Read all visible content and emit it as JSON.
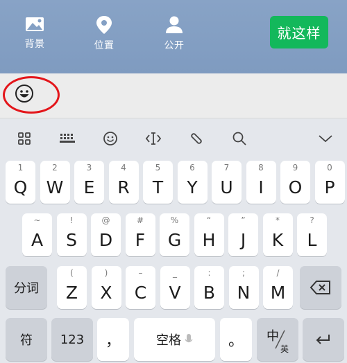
{
  "toolbar": {
    "background_label": "背景",
    "location_label": "位置",
    "public_label": "公开",
    "confirm_label": "就这样"
  },
  "keyboard": {
    "row1": [
      {
        "letter": "Q",
        "hint": "1"
      },
      {
        "letter": "W",
        "hint": "2"
      },
      {
        "letter": "E",
        "hint": "3"
      },
      {
        "letter": "R",
        "hint": "4"
      },
      {
        "letter": "T",
        "hint": "5"
      },
      {
        "letter": "Y",
        "hint": "6"
      },
      {
        "letter": "U",
        "hint": "7"
      },
      {
        "letter": "I",
        "hint": "8"
      },
      {
        "letter": "O",
        "hint": "9"
      },
      {
        "letter": "P",
        "hint": "0"
      }
    ],
    "row2": [
      {
        "letter": "A",
        "hint": "~"
      },
      {
        "letter": "S",
        "hint": "!"
      },
      {
        "letter": "D",
        "hint": "@"
      },
      {
        "letter": "F",
        "hint": "#"
      },
      {
        "letter": "G",
        "hint": "%"
      },
      {
        "letter": "H",
        "hint": "“"
      },
      {
        "letter": "J",
        "hint": "”"
      },
      {
        "letter": "K",
        "hint": "*"
      },
      {
        "letter": "L",
        "hint": "?"
      }
    ],
    "row3": [
      {
        "letter": "Z",
        "hint": "("
      },
      {
        "letter": "X",
        "hint": ")"
      },
      {
        "letter": "C",
        "hint": "–"
      },
      {
        "letter": "V",
        "hint": "_"
      },
      {
        "letter": "B",
        "hint": ":"
      },
      {
        "letter": "N",
        "hint": ";"
      },
      {
        "letter": "M",
        "hint": "/"
      }
    ],
    "segment_label": "分词",
    "symbol_label": "符",
    "numbers_label": "123",
    "comma_label": "，",
    "space_label": "空格",
    "period_label": "。",
    "lang_main": "中",
    "lang_sub": "英",
    "enter_symbol": "↵"
  },
  "colors": {
    "topbar": "#84a0c4",
    "confirm_button": "#13b85b",
    "highlight_circle": "#e3151a"
  }
}
